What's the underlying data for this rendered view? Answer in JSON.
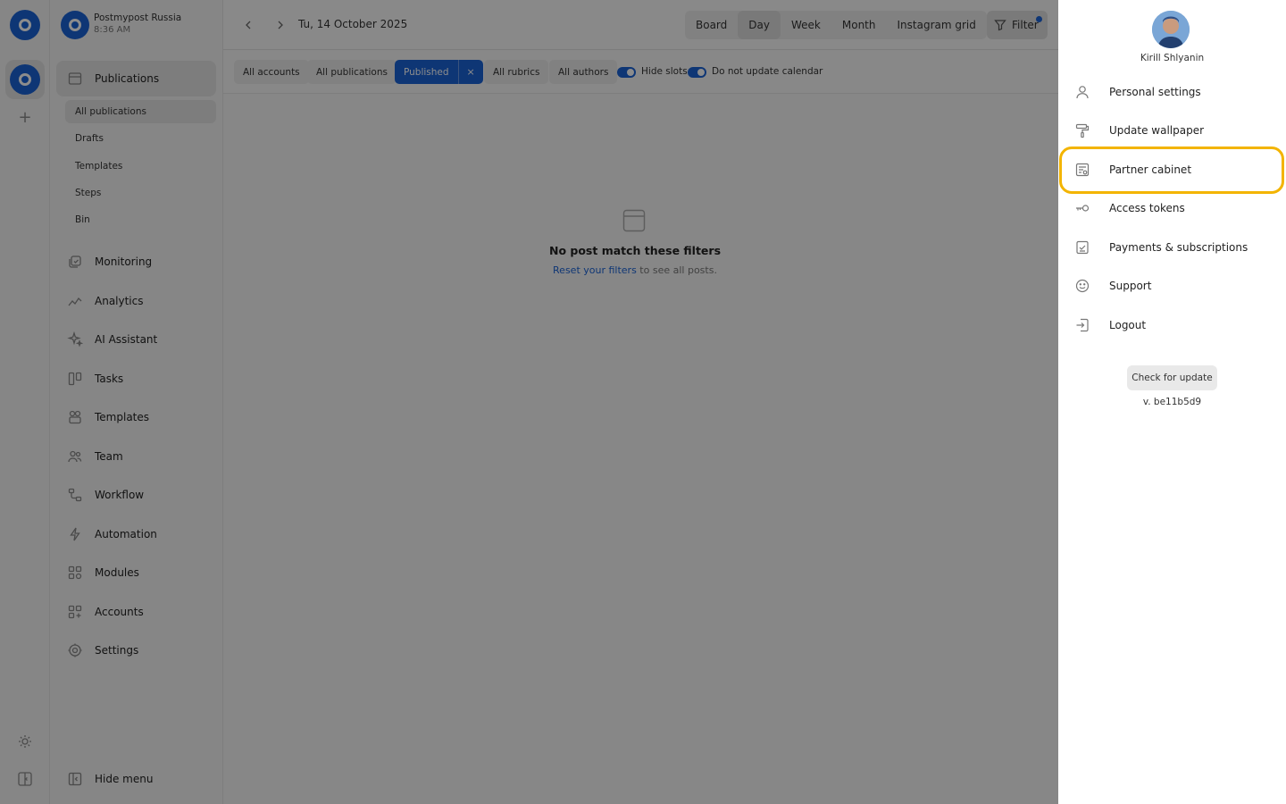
{
  "workspace": {
    "name": "Postmypost Russia",
    "time": "8:36 AM"
  },
  "sidebar": {
    "publications_label": "Publications",
    "sub_items": [
      "All publications",
      "Drafts",
      "Templates",
      "Steps",
      "Bin"
    ],
    "items": [
      "Monitoring",
      "Analytics",
      "AI Assistant",
      "Tasks",
      "Templates",
      "Team",
      "Workflow",
      "Automation",
      "Modules",
      "Accounts",
      "Settings"
    ],
    "hide_menu_label": "Hide menu"
  },
  "topbar": {
    "date": "Tu, 14 October 2025",
    "views": [
      "Board",
      "Day",
      "Week",
      "Month",
      "Instagram grid"
    ],
    "active_view": "Day",
    "filter_label": "Filter"
  },
  "filters": {
    "all_accounts": "All accounts",
    "all_publications": "All publications",
    "published": "Published",
    "all_rubrics": "All rubrics",
    "all_authors": "All authors",
    "hide_slots": "Hide slots",
    "do_not_update": "Do not update calendar",
    "remove_symbol": "×"
  },
  "empty_state": {
    "title": "No post match these filters",
    "link": "Reset your filters",
    "rest": " to see all posts."
  },
  "user_panel": {
    "name": "Kirill Shlyanin",
    "items": [
      "Personal settings",
      "Update wallpaper",
      "Partner cabinet",
      "Access tokens",
      "Payments & subscriptions",
      "Support",
      "Logout"
    ],
    "check_update": "Check for update",
    "version": "v. be11b5d9"
  },
  "colors": {
    "accent": "#1b63d6",
    "highlight": "#f3b400"
  }
}
